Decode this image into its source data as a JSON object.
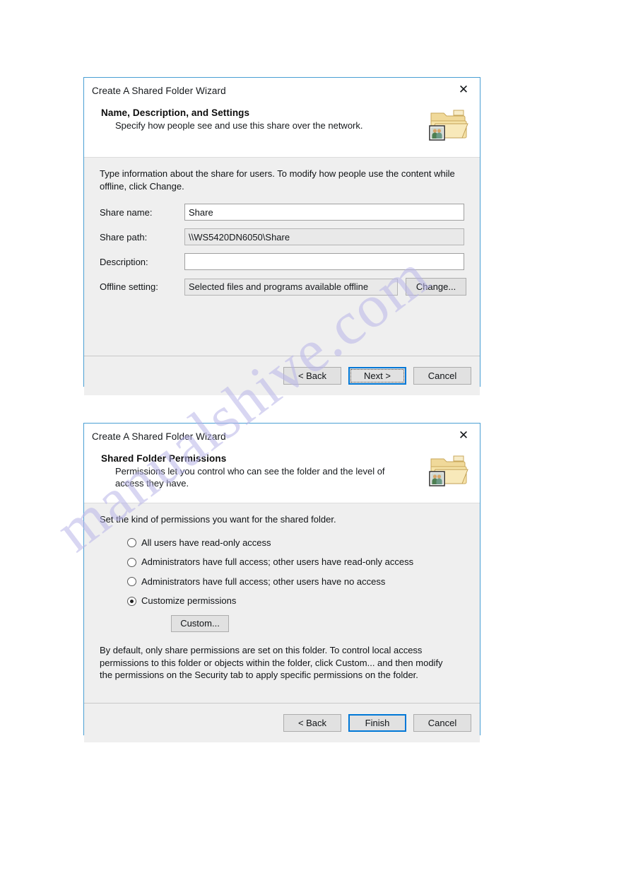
{
  "watermark": {
    "text": "manualshive.com"
  },
  "dialog1": {
    "title": "Create A Shared Folder Wizard",
    "close_label": "✕",
    "icon_name": "shared-folder-icon",
    "header": {
      "heading": "Name, Description, and Settings",
      "subtitle": "Specify how people see and use this share over the network."
    },
    "intro": "Type information about the share for users. To modify how people use the content while offline, click Change.",
    "fields": [
      {
        "label": "Share name:",
        "value": "Share",
        "readonly": false
      },
      {
        "label": "Share path:",
        "value": "\\\\WS5420DN6050\\Share",
        "readonly": true
      },
      {
        "label": "Description:",
        "value": "",
        "readonly": false
      },
      {
        "label": "Offline setting:",
        "value": "Selected files and programs available offline",
        "readonly": true
      }
    ],
    "change_button": "Change...",
    "buttons": {
      "back": "< Back",
      "next": "Next >",
      "cancel": "Cancel"
    }
  },
  "dialog2": {
    "title": "Create A Shared Folder Wizard",
    "close_label": "✕",
    "icon_name": "shared-folder-icon",
    "header": {
      "heading": "Shared Folder Permissions",
      "subtitle": "Permissions let you control who can see the folder and the level of access they have."
    },
    "intro": "Set the kind of permissions you want for the shared folder.",
    "options": [
      {
        "label": "All users have read-only access",
        "selected": false
      },
      {
        "label": "Administrators have full access; other users have read-only access",
        "selected": false
      },
      {
        "label": "Administrators have full access; other users have no access",
        "selected": false
      },
      {
        "label": "Customize permissions",
        "selected": true
      }
    ],
    "custom_button": "Custom...",
    "note": "By default, only share permissions are set on this folder. To control local access permissions to this folder or objects within the folder, click Custom... and then modify the permissions on the Security tab to apply specific permissions on the folder.",
    "buttons": {
      "back": "< Back",
      "finish": "Finish",
      "cancel": "Cancel"
    }
  },
  "colors": {
    "dialog_border": "#4a9fd4",
    "accent_focus": "#0078d7",
    "content_bg": "#efefef",
    "folder_fill": "#f5dfa0",
    "watermark": "#b9b5e8"
  }
}
